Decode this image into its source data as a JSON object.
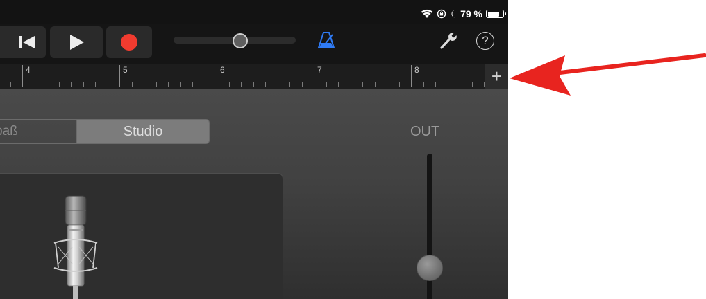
{
  "status_bar": {
    "battery_percent": "79 %",
    "battery_level": 0.79,
    "icons": [
      "wifi-icon",
      "orientation-lock-icon",
      "moon-icon",
      "battery-icon"
    ]
  },
  "toolbar": {
    "rewind_icon": "rewind-to-start-icon",
    "play_icon": "play-icon",
    "record_icon": "record-icon",
    "record_color": "#f13b2f",
    "volume_level": 0.55,
    "metronome_icon": "metronome-icon",
    "metronome_color": "#2f7bf5",
    "settings_icon": "wrench-icon",
    "help_label": "?"
  },
  "ruler": {
    "bars": [
      "4",
      "5",
      "6",
      "7",
      "8"
    ],
    "add_label": "+"
  },
  "mode_segment": {
    "options": [
      "paß",
      "Studio"
    ],
    "selected": "Studio"
  },
  "output": {
    "label": "OUT",
    "level": 0.2
  },
  "annotation": {
    "arrow_color": "#e8241f"
  }
}
